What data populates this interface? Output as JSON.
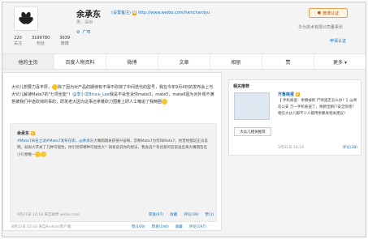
{
  "profile": {
    "name": "余承东",
    "settings_link": "(设置备注)",
    "v_badge": "V",
    "url_label": "http://www.weibo.com/hwnchardyu",
    "location": "男，深圳",
    "tags_icon": "gear-icon",
    "tags_text": "广布",
    "stats": [
      {
        "value": "220",
        "label": "关注"
      },
      {
        "value": "3199780",
        "label": "粉丝"
      },
      {
        "value": "3639",
        "label": "微博"
      }
    ],
    "verify_button": "微博认证",
    "verify_desc": "华为技术有限公司董事长",
    "verify_link": "申请认证"
  },
  "tabs": [
    "他的主页",
    "百度人物资料",
    "微博",
    "文章",
    "相册",
    "赞",
    "更多 ▾"
  ],
  "post": {
    "text_1": "大伙儿想要力喜丰厚，",
    "text_2": "除了因为对产品的期待有不得不砍掉了中间迭代的型号，我在今年9月4日的发布会上与大伙儿解读Mate7的\"七项全能\"！",
    "mention": "@李小龙Bruce_Lee",
    "text_3": "我是不会告诉你mate3，mate5，mate6因为对外观不满意被我们中途砍掉的事的，研发老大因为这事还拿着砍刀围着上研人工嘲追了我两圈",
    "repost": {
      "author": "余承东",
      "v_badge": "V",
      "text_a": "#Mate7命名之谜#Mate7发布在即，",
      "mention": "@余承东",
      "text_b": "大嘴期期关获很兴奋啊，忽略Mate7为何叫Mate7，他曾经都说正派说明，就再大开关了几种可能性，你们觉得哪种可能性大？研发说说你的想法，我会选个有创意的答案送出来大嘴期签名小礼物喔~",
      "time": "8月21日 14:18  来自微博 weibo.com",
      "actions": [
        "转发(97)",
        "收藏",
        "评论(39)",
        "赞(1)"
      ]
    },
    "time": "8月22日 22:03  来自Android客户端",
    "actions": [
      "赞(169)",
      "转发(194)",
      "收藏",
      "评论(197)"
    ]
  },
  "side": {
    "title": "相关推荐",
    "caption": "大伙儿相关推荐",
    "author": "齐鲁晚报",
    "v_badge": "V",
    "text": "【 手机被盗：余鹏被抓 尸财盗走怎么办？】@青岛公安 万一手机被盗了，余鹏宝鹏户安全隐患？ 相信大伙儿都不少人都用余鹏发相关建议！",
    "time": "3月31日 14:18",
    "comment": "评论(38)"
  }
}
